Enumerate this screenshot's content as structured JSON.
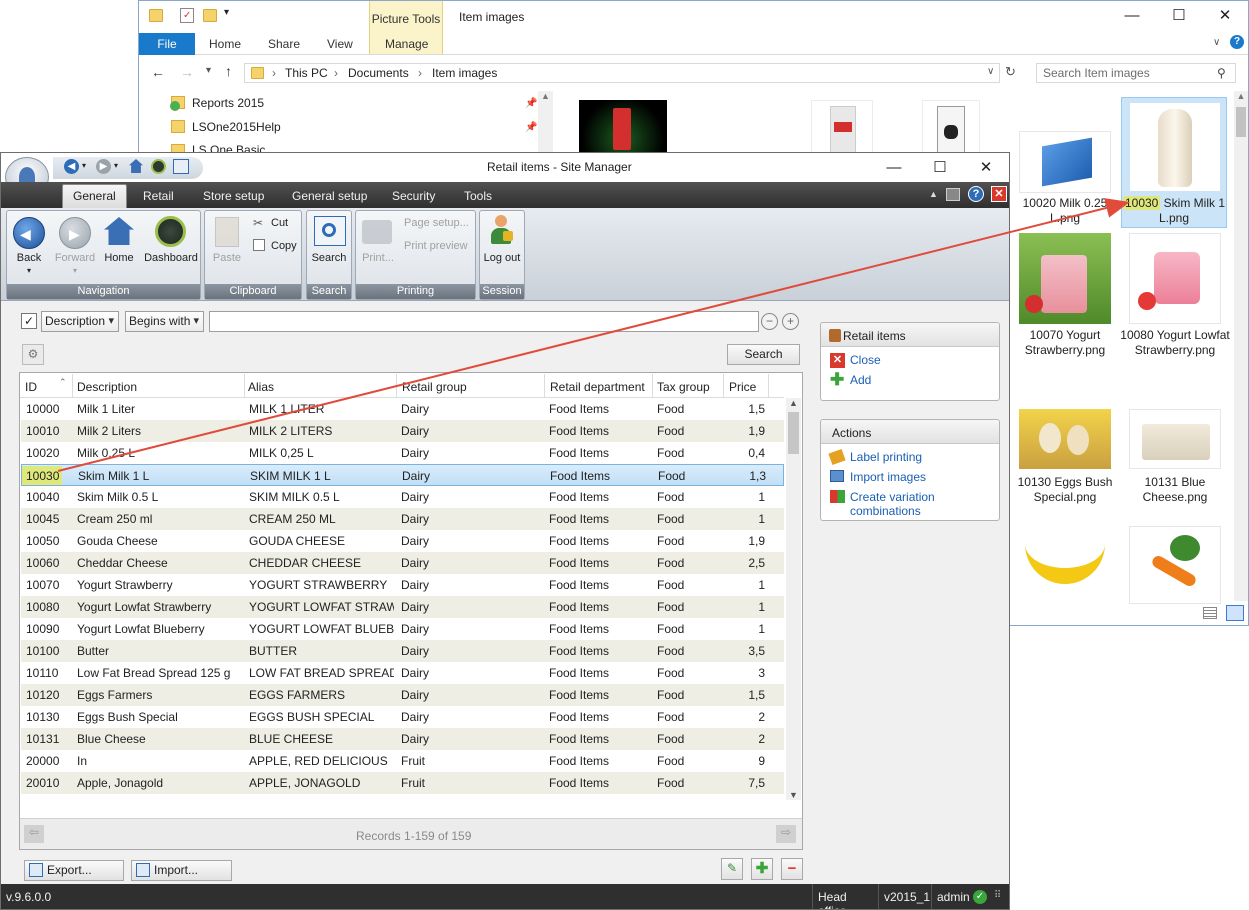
{
  "explorer": {
    "context_tab": "Picture Tools",
    "title": "Item images",
    "tabs": {
      "file": "File",
      "home": "Home",
      "share": "Share",
      "view": "View",
      "manage": "Manage"
    },
    "breadcrumb": [
      "This PC",
      "Documents",
      "Item images"
    ],
    "search_placeholder": "Search Item images",
    "nav_items": [
      "Reports 2015",
      "LSOne2015Help",
      "LS One Basic"
    ],
    "thumbnails": [
      {
        "caption": "10020 Milk 0.25 L.png"
      },
      {
        "caption_highlight": "10030",
        "caption_rest": " Skim Milk 1 L.png",
        "selected": true
      },
      {
        "caption": "10070 Yogurt Strawberry.png"
      },
      {
        "caption": "10080 Yogurt Lowfat Strawberry.png"
      },
      {
        "caption": "10130 Eggs Bush Special.png"
      },
      {
        "caption": "10131 Blue Cheese.png"
      }
    ]
  },
  "site_manager": {
    "title": "Retail items - Site Manager",
    "tabs": [
      "General",
      "Retail",
      "Store setup",
      "General setup",
      "Security",
      "Tools"
    ],
    "ribbon": {
      "navigation": {
        "label": "Navigation",
        "back": "Back",
        "forward": "Forward",
        "home": "Home",
        "dashboard": "Dashboard"
      },
      "clipboard": {
        "label": "Clipboard",
        "paste": "Paste",
        "cut": "Cut",
        "copy": "Copy"
      },
      "search": {
        "label": "Search",
        "search": "Search"
      },
      "printing": {
        "label": "Printing",
        "print": "Print...",
        "page_setup": "Page setup...",
        "print_preview": "Print preview"
      },
      "session": {
        "label": "Session",
        "logout": "Log out"
      }
    },
    "filter": {
      "field": "Description",
      "operator": "Begins with",
      "value": "",
      "search_button": "Search"
    },
    "columns": [
      "ID",
      "Description",
      "Alias",
      "Retail group",
      "Retail department",
      "Tax group",
      "Price"
    ],
    "rows": [
      [
        "10000",
        "Milk 1 Liter",
        "MILK 1 LITER",
        "Dairy",
        "Food Items",
        "Food",
        "1,5"
      ],
      [
        "10010",
        "Milk 2 Liters",
        "MILK 2 LITERS",
        "Dairy",
        "Food Items",
        "Food",
        "1,9"
      ],
      [
        "10020",
        "Milk 0,25 L",
        "MILK 0,25 L",
        "Dairy",
        "Food Items",
        "Food",
        "0,4"
      ],
      [
        "10030",
        "Skim Milk 1 L",
        "SKIM MILK 1 L",
        "Dairy",
        "Food Items",
        "Food",
        "1,3"
      ],
      [
        "10040",
        "Skim Milk 0.5 L",
        "SKIM MILK 0.5 L",
        "Dairy",
        "Food Items",
        "Food",
        "1"
      ],
      [
        "10045",
        "Cream 250 ml",
        "CREAM 250 ML",
        "Dairy",
        "Food Items",
        "Food",
        "1"
      ],
      [
        "10050",
        "Gouda Cheese",
        "GOUDA CHEESE",
        "Dairy",
        "Food Items",
        "Food",
        "1,9"
      ],
      [
        "10060",
        "Cheddar Cheese",
        "CHEDDAR CHEESE",
        "Dairy",
        "Food Items",
        "Food",
        "2,5"
      ],
      [
        "10070",
        "Yogurt Strawberry",
        "YOGURT STRAWBERRY",
        "Dairy",
        "Food Items",
        "Food",
        "1"
      ],
      [
        "10080",
        "Yogurt Lowfat Strawberry",
        "YOGURT LOWFAT STRAWB",
        "Dairy",
        "Food Items",
        "Food",
        "1"
      ],
      [
        "10090",
        "Yogurt Lowfat Blueberry",
        "YOGURT LOWFAT BLUEBE",
        "Dairy",
        "Food Items",
        "Food",
        "1"
      ],
      [
        "10100",
        "Butter",
        "BUTTER",
        "Dairy",
        "Food Items",
        "Food",
        "3,5"
      ],
      [
        "10110",
        "Low Fat Bread Spread 125 g",
        "LOW FAT BREAD SPREAD",
        "Dairy",
        "Food Items",
        "Food",
        "3"
      ],
      [
        "10120",
        "Eggs Farmers",
        "EGGS FARMERS",
        "Dairy",
        "Food Items",
        "Food",
        "1,5"
      ],
      [
        "10130",
        "Eggs Bush Special",
        "EGGS BUSH SPECIAL",
        "Dairy",
        "Food Items",
        "Food",
        "2"
      ],
      [
        "10131",
        "Blue Cheese",
        "BLUE CHEESE",
        "Dairy",
        "Food Items",
        "Food",
        "2"
      ],
      [
        "20000",
        "In",
        "APPLE, RED DELICIOUS",
        "Fruit",
        "Food Items",
        "Food",
        "9"
      ],
      [
        "20010",
        "Apple, Jonagold",
        "APPLE, JONAGOLD",
        "Fruit",
        "Food Items",
        "Food",
        "7,5"
      ]
    ],
    "selected_id": "10030",
    "records": "Records 1-159 of 159",
    "retail_items_panel": {
      "title": "Retail items",
      "close": "Close",
      "add": "Add"
    },
    "actions_panel": {
      "title": "Actions",
      "label_printing": "Label printing",
      "import_images": "Import images",
      "create_variations": "Create variation combinations"
    },
    "export_button": "Export...",
    "import_button": "Import...",
    "status": {
      "version": "v.9.6.0.0",
      "store": "Head office",
      "db": "v2015_1",
      "user": "admin"
    }
  },
  "colors": {
    "accent": "#1979ca",
    "selection": "#c1dff6",
    "link": "#1a5fb4",
    "arrow": "#e04b3c",
    "highlight": "#dfe87a"
  }
}
